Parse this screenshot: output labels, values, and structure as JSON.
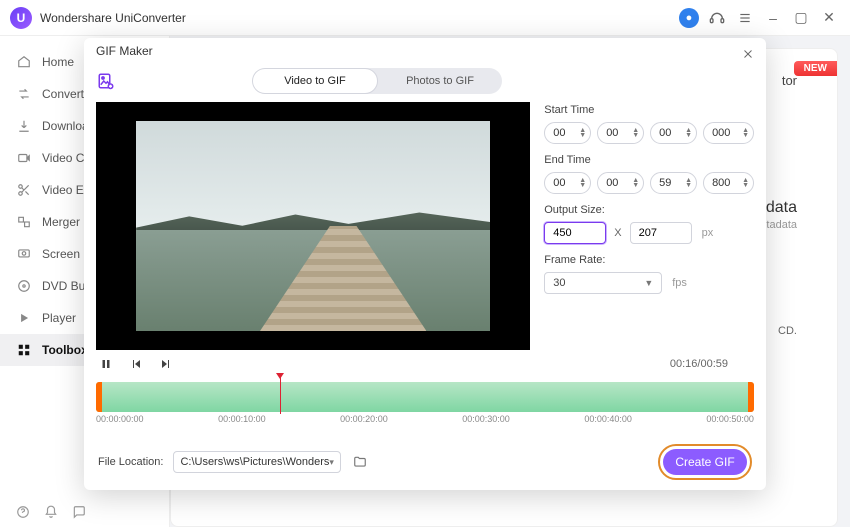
{
  "app": {
    "name": "Wondershare UniConverter"
  },
  "window_icons": {
    "min": "–",
    "max": "▢",
    "close": "✕"
  },
  "sidebar": {
    "items": [
      {
        "label": "Home"
      },
      {
        "label": "Converter"
      },
      {
        "label": "Downloader"
      },
      {
        "label": "Video Compressor"
      },
      {
        "label": "Video Editor"
      },
      {
        "label": "Merger"
      },
      {
        "label": "Screen Recorder"
      },
      {
        "label": "DVD Burner"
      },
      {
        "label": "Player"
      },
      {
        "label": "Toolbox"
      }
    ]
  },
  "background": {
    "new_badge": "NEW",
    "word_tor": "tor",
    "word_tadata": "tadata",
    "word_etadata": "etadata",
    "word_cd": "CD."
  },
  "modal": {
    "title": "GIF Maker",
    "tabs": {
      "video": "Video to GIF",
      "photos": "Photos to GIF"
    },
    "labels": {
      "start": "Start Time",
      "end": "End Time",
      "output_size": "Output Size:",
      "frame_rate": "Frame Rate:",
      "file_location": "File Location:"
    },
    "start_time": {
      "hh": "00",
      "mm": "00",
      "ss": "00",
      "ms": "000"
    },
    "end_time": {
      "hh": "00",
      "mm": "00",
      "ss": "59",
      "ms": "800"
    },
    "output": {
      "w": "450",
      "h": "207",
      "px": "px",
      "x": "X"
    },
    "fps": {
      "value": "30",
      "unit": "fps"
    },
    "time_display": "00:16/00:59",
    "ticks": [
      "00:00:00:00",
      "00:00:10:00",
      "00:00:20:00",
      "00:00:30:00",
      "00:00:40:00",
      "00:00:50:00"
    ],
    "file_path": "C:\\Users\\ws\\Pictures\\Wonders",
    "create": "Create GIF"
  }
}
